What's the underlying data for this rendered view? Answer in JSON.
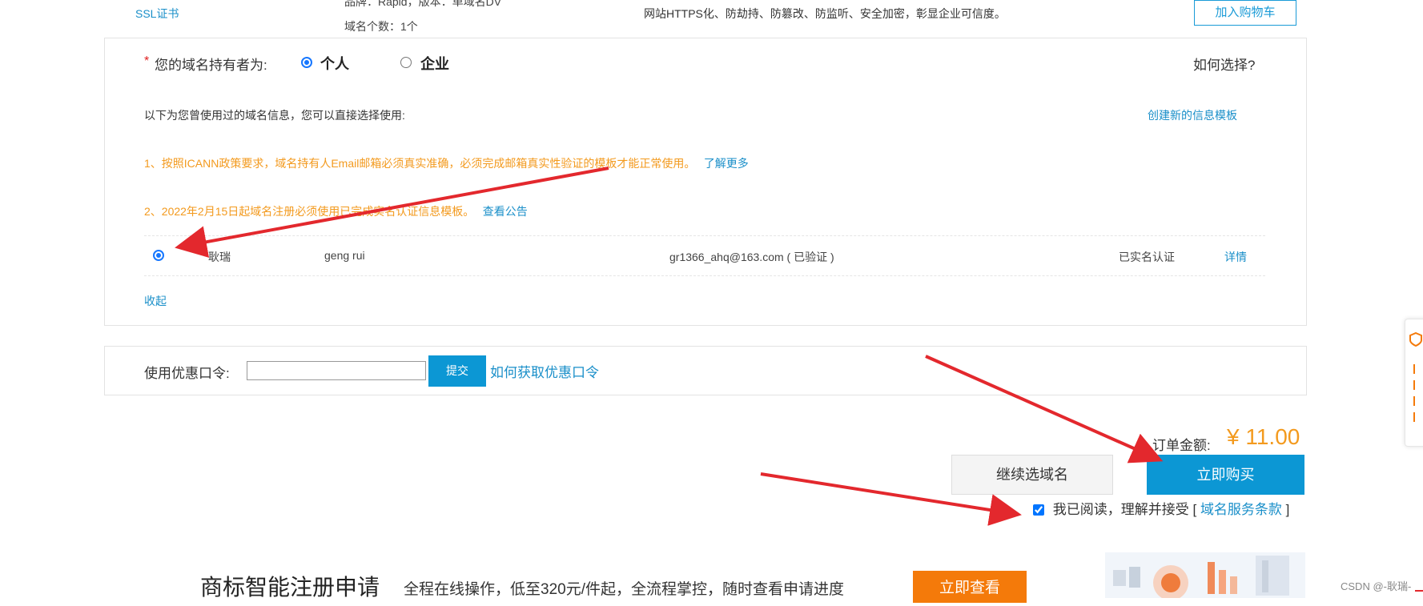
{
  "top": {
    "product_link": "SSL证书",
    "brand_line": "品牌：Rapid，版本：单域名DV",
    "domain_count": "域名个数：1个",
    "description": "网站HTTPS化、防劫持、防篡改、防监听、安全加密，彰显企业可信度。",
    "add_cart_label": "加入购物车"
  },
  "holder": {
    "required_mark": "*",
    "label": "您的域名持有者为:",
    "option_personal": "个人",
    "option_company": "企业",
    "help_link": "如何选择?",
    "used_info_text": "以下为您曾使用过的域名信息，您可以直接选择使用:",
    "create_template_link": "创建新的信息模板",
    "notice1": "1、按照ICANN政策要求，域名持有人Email邮箱必须真实准确，必须完成邮箱真实性验证的模板才能正常使用。",
    "notice1_link": "了解更多",
    "notice2": "2、2022年2月15日起域名注册必须使用已完成实名认证信息模板。",
    "notice2_link": "查看公告",
    "record": {
      "name": "耿瑞",
      "pinyin": "geng rui",
      "email": "gr1366_ahq@163.com ( 已验证 )",
      "status": "已实名认证",
      "detail_link": "详情"
    },
    "collapse_link": "收起"
  },
  "coupon": {
    "label": "使用优惠口令:",
    "input_value": "",
    "submit_label": "提交",
    "help_link": "如何获取优惠口令"
  },
  "order": {
    "total_label": "订单金额:",
    "total_value": "¥ 11.00",
    "continue_label": "继续选域名",
    "buy_label": "立即购买",
    "agree_text": "我已阅读，理解并接受",
    "bracket_open": "[",
    "terms_link": "域名服务条款",
    "bracket_close": "]"
  },
  "banner": {
    "title": "商标智能注册申请",
    "subtitle": "全程在线操作，低至320元/件起，全流程掌控，随时查看申请进度",
    "cta_label": "立即查看"
  },
  "watermark": "CSDN @-耿瑞-",
  "colors": {
    "accent_blue": "#1a9bd7",
    "buy_button": "#0c97d4",
    "price_orange": "#f39a1e",
    "cta_orange": "#f47a0a",
    "arrow_red": "#e3282d"
  }
}
